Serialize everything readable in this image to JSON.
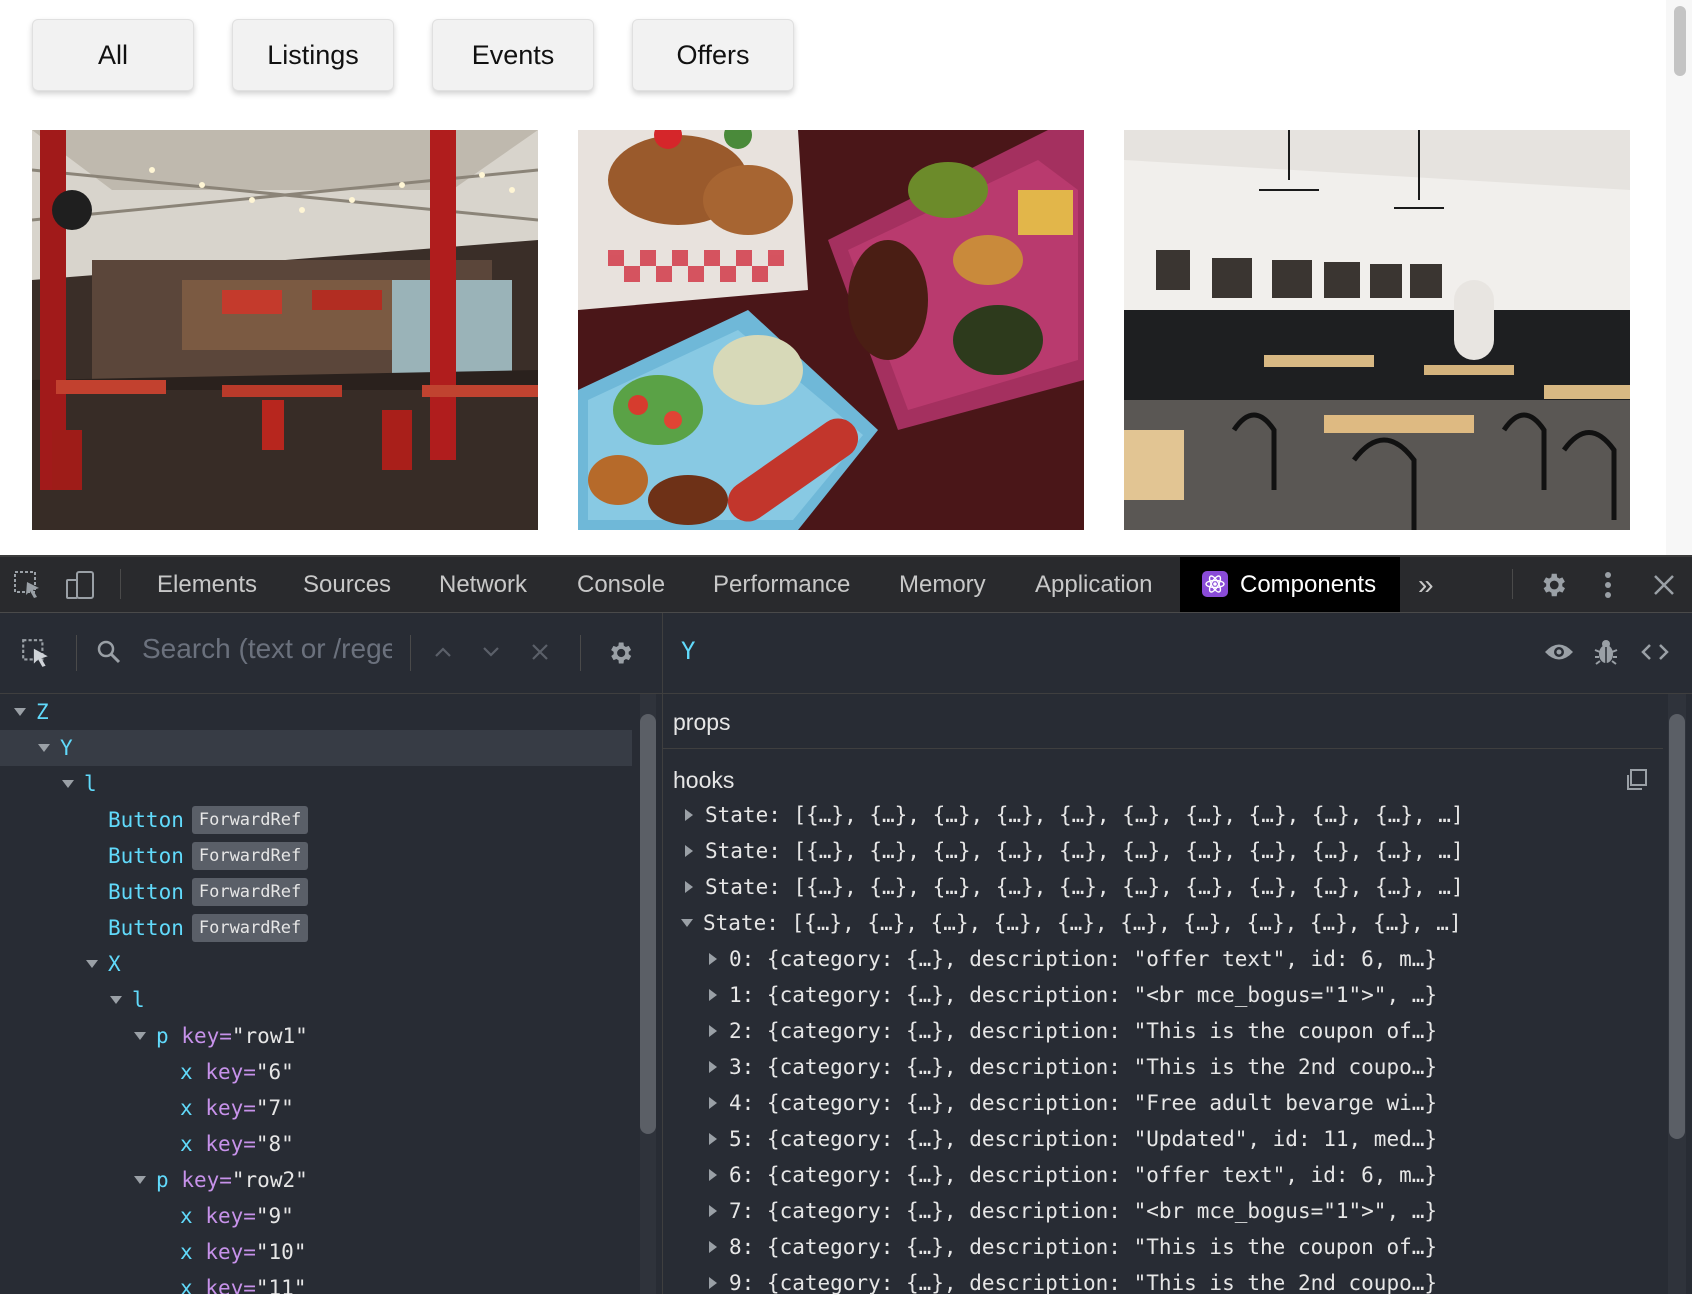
{
  "filters": [
    "All",
    "Listings",
    "Events",
    "Offers"
  ],
  "devtools": {
    "tabs": [
      "Elements",
      "Sources",
      "Network",
      "Console",
      "Performance",
      "Memory",
      "Application"
    ],
    "active_tab": "Components",
    "more_label": "»"
  },
  "components": {
    "search_placeholder": "Search (text or /rege",
    "selected": "Y",
    "tree": {
      "z": "Z",
      "y": "Y",
      "l1": "l",
      "button": "Button",
      "forwardref": "ForwardRef",
      "x": "X",
      "l2": "l",
      "p": "p",
      "key_attr": "key=",
      "row1": "\"row1\"",
      "row2": "\"row2\"",
      "x_small": "x",
      "k6": "\"6\"",
      "k7": "\"7\"",
      "k8": "\"8\"",
      "k9": "\"9\"",
      "k10": "\"10\"",
      "k11": "\"11\""
    },
    "props_label": "props",
    "hooks_label": "hooks",
    "states": [
      "State: [{…}, {…}, {…}, {…}, {…}, {…}, {…}, {…}, {…}, {…}, …]",
      "State: [{…}, {…}, {…}, {…}, {…}, {…}, {…}, {…}, {…}, {…}, …]",
      "State: [{…}, {…}, {…}, {…}, {…}, {…}, {…}, {…}, {…}, {…}, …]",
      "State: [{…}, {…}, {…}, {…}, {…}, {…}, {…}, {…}, {…}, {…}, …]"
    ],
    "items": [
      "0: {category: {…}, description: \"offer text\", id: 6, m…}",
      "1: {category: {…}, description: \"<br mce_bogus=\"1\">\", …}",
      "2: {category: {…}, description: \"This is the coupon of…}",
      "3: {category: {…}, description: \"This is the 2nd coupo…}",
      "4: {category: {…}, description: \"Free adult bevarge wi…}",
      "5: {category: {…}, description: \"Updated\", id: 11, med…}",
      "6: {category: {…}, description: \"offer text\", id: 6, m…}",
      "7: {category: {…}, description: \"<br mce_bogus=\"1\">\", …}",
      "8: {category: {…}, description: \"This is the coupon of…}",
      "9: {category: {…}, description: \"This is the 2nd coupo…}"
    ]
  }
}
